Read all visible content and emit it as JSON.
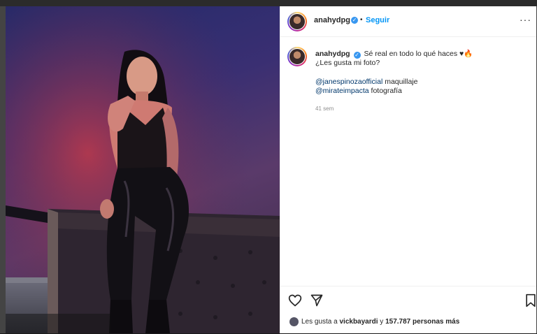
{
  "post": {
    "username": "anahydpg",
    "follow_label": "Seguir",
    "separator": "•",
    "more_label": "•••",
    "caption_line1": "Sé real en todo lo qué haces ♥🔥",
    "caption_line2": "¿Les gusta mi foto?",
    "credit1_mention": "@janespinozaofficial",
    "credit1_text": " maquillaje",
    "credit2_mention": "@mirateimpacta",
    "credit2_text": " fotografía",
    "time_ago": "41 sem",
    "likes_prefix": "Les gusta a ",
    "likes_user": "vickbayardi",
    "likes_middle": " y ",
    "likes_count": "157.787 personas más"
  },
  "icons": {
    "like": "heart-icon",
    "share": "paper-plane-icon",
    "save": "bookmark-icon",
    "verified": "verified-badge-icon",
    "more": "more-options-icon"
  },
  "colors": {
    "accent": "#0095f6",
    "verified": "#3897f0",
    "mention": "#00376b"
  }
}
